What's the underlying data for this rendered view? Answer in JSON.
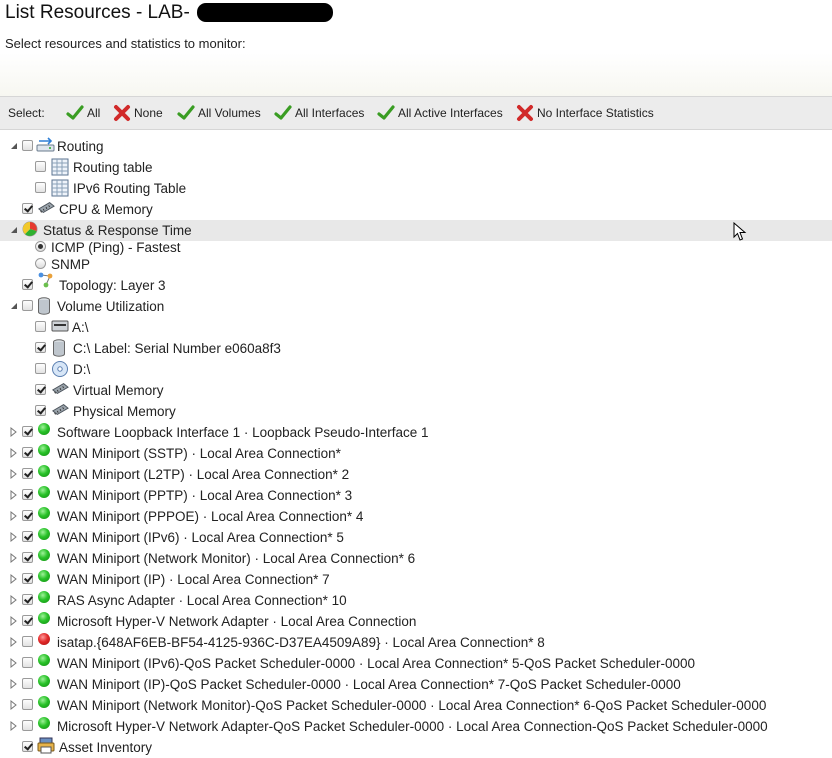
{
  "header": {
    "title": "List Resources - LAB-",
    "subtitle": "Select resources and statistics to monitor:"
  },
  "toolbar": {
    "label": "Select:",
    "items": [
      {
        "label": "All",
        "icon": "check-icon"
      },
      {
        "label": "None",
        "icon": "x-icon"
      },
      {
        "label": "All Volumes",
        "icon": "check-icon"
      },
      {
        "label": "All Interfaces",
        "icon": "check-icon"
      },
      {
        "label": "All Active Interfaces",
        "icon": "check-icon"
      },
      {
        "label": "No Interface Statistics",
        "icon": "x-icon"
      }
    ]
  },
  "tree": {
    "routing": "Routing",
    "routing_table": "Routing table",
    "ipv6_routing_table": "IPv6 Routing Table",
    "cpu_memory": "CPU & Memory",
    "status_response_time": "Status & Response Time",
    "icmp": "ICMP (Ping) - Fastest",
    "snmp": "SNMP",
    "topology": "Topology: Layer 3",
    "volume_utilization": "Volume Utilization",
    "volumes": [
      {
        "label": "A:\\",
        "checked": false,
        "icon": "drive-icon"
      },
      {
        "label": "C:\\ Label: Serial Number e060a8f3",
        "checked": true,
        "icon": "disk-cylinder-icon"
      },
      {
        "label": "D:\\",
        "checked": false,
        "icon": "cd-icon"
      },
      {
        "label": "Virtual Memory",
        "checked": true,
        "icon": "memory-icon"
      },
      {
        "label": "Physical Memory",
        "checked": true,
        "icon": "memory-icon"
      }
    ],
    "interfaces": [
      {
        "label": "Software Loopback Interface 1 · Loopback Pseudo-Interface 1",
        "checked": true,
        "status": "up"
      },
      {
        "label": "WAN Miniport (SSTP) · Local Area Connection*",
        "checked": true,
        "status": "up"
      },
      {
        "label": "WAN Miniport (L2TP) · Local Area Connection* 2",
        "checked": true,
        "status": "up"
      },
      {
        "label": "WAN Miniport (PPTP) · Local Area Connection* 3",
        "checked": true,
        "status": "up"
      },
      {
        "label": "WAN Miniport (PPPOE) · Local Area Connection* 4",
        "checked": true,
        "status": "up"
      },
      {
        "label": "WAN Miniport (IPv6) · Local Area Connection* 5",
        "checked": true,
        "status": "up"
      },
      {
        "label": "WAN Miniport (Network Monitor) · Local Area Connection* 6",
        "checked": true,
        "status": "up"
      },
      {
        "label": "WAN Miniport (IP) · Local Area Connection* 7",
        "checked": true,
        "status": "up"
      },
      {
        "label": "RAS Async Adapter · Local Area Connection* 10",
        "checked": true,
        "status": "up"
      },
      {
        "label": "Microsoft Hyper-V Network Adapter · Local Area Connection",
        "checked": true,
        "status": "up"
      },
      {
        "label": "isatap.{648AF6EB-BF54-4125-936C-D37EA4509A89} · Local Area Connection* 8",
        "checked": false,
        "status": "down"
      },
      {
        "label": "WAN Miniport (IPv6)-QoS Packet Scheduler-0000 · Local Area Connection* 5-QoS Packet Scheduler-0000",
        "checked": false,
        "status": "up"
      },
      {
        "label": "WAN Miniport (IP)-QoS Packet Scheduler-0000 · Local Area Connection* 7-QoS Packet Scheduler-0000",
        "checked": false,
        "status": "up"
      },
      {
        "label": "WAN Miniport (Network Monitor)-QoS Packet Scheduler-0000 · Local Area Connection* 6-QoS Packet Scheduler-0000",
        "checked": false,
        "status": "up"
      },
      {
        "label": "Microsoft Hyper-V Network Adapter-QoS Packet Scheduler-0000 · Local Area Connection-QoS Packet Scheduler-0000",
        "checked": false,
        "status": "up"
      }
    ],
    "asset_inventory": "Asset Inventory"
  },
  "colors": {
    "check_green": "#3a9d23",
    "x_red": "#d12a2a",
    "status_up": "#29c229",
    "status_down": "#e22a2a",
    "toolbar_bg": "#ececec",
    "row_highlight": "#e8e8e8"
  }
}
